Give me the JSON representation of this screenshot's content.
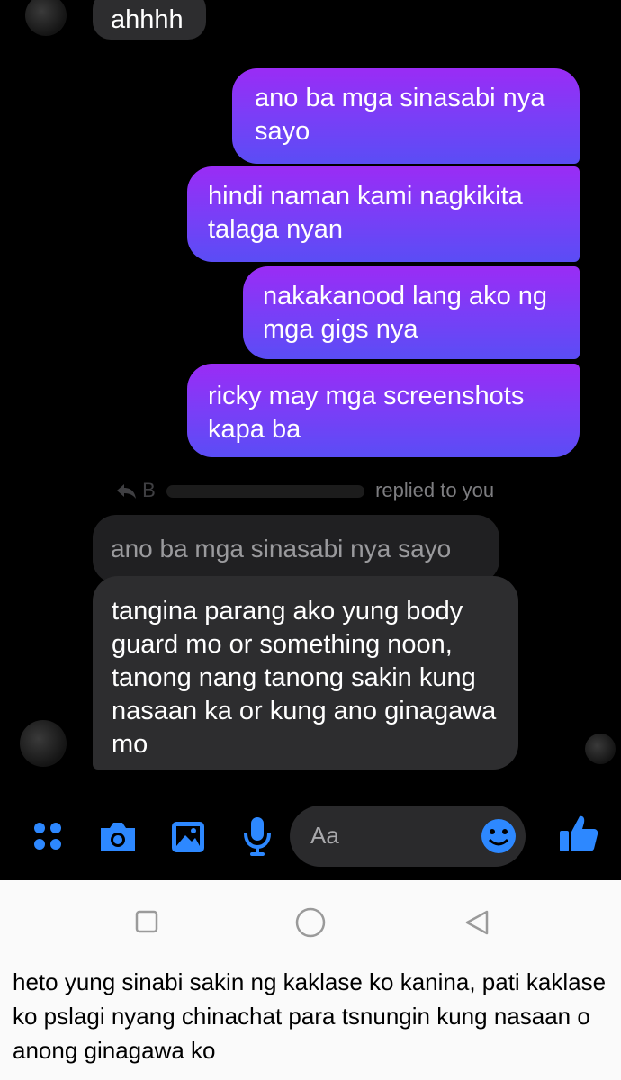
{
  "messages": [
    {
      "from": "contact",
      "text": "ahhhh"
    },
    {
      "from": "me",
      "text": "ano ba mga sinasabi nya sayo"
    },
    {
      "from": "me",
      "text": "hindi naman kami nagkikita talaga nyan"
    },
    {
      "from": "me",
      "text": "nakakanood lang ako ng mga gigs nya"
    },
    {
      "from": "me",
      "text": "ricky may mga screenshots kapa ba"
    },
    {
      "from": "contact",
      "text": "tangina parang ako yung body guard mo or something noon, tanong nang tanong sakin kung nasaan ka or kung ano ginagawa mo"
    }
  ],
  "reply": {
    "header_initial": "B",
    "header_text": "replied to you",
    "quoted_text": "ano ba mga sinasabi nya sayo"
  },
  "composer": {
    "placeholder": "Aa",
    "icons": [
      "menu-dots-icon",
      "camera-icon",
      "gallery-icon",
      "microphone-icon",
      "emoji-icon",
      "thumbs-up-icon"
    ],
    "accent_color": "#2d88ff"
  },
  "navbar": {
    "icons": [
      "recents-square-icon",
      "home-circle-icon",
      "back-triangle-icon"
    ]
  },
  "caption": "heto yung sinabi sakin ng kaklase ko kanina, pati kaklase ko pslagi nyang chinachat para tsnungin kung nasaan o anong ginagawa ko"
}
